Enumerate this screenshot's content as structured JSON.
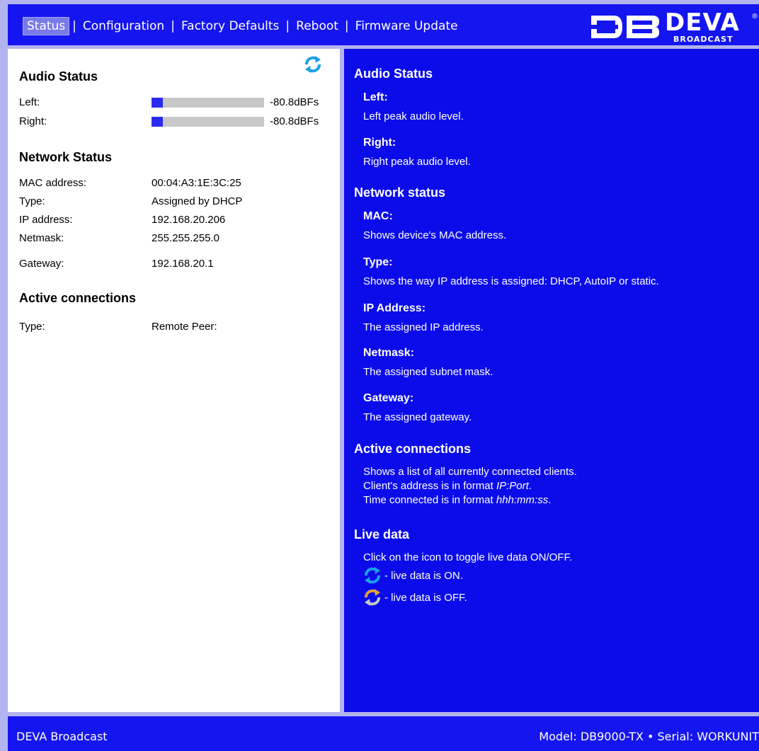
{
  "nav": {
    "items": [
      "Status",
      "Configuration",
      "Factory Defaults",
      "Reboot",
      "Firmware Update"
    ],
    "separator": "|",
    "active": "Status"
  },
  "logo": {
    "word": "DEVA",
    "sub": "BROADCAST",
    "reg": "®"
  },
  "left": {
    "audio_title": "Audio Status",
    "left_label": "Left:",
    "left_value": "-80.8dBFs",
    "left_level_fraction": 0.1,
    "right_label": "Right:",
    "right_value": "-80.8dBFs",
    "right_level_fraction": 0.1,
    "network_title": "Network Status",
    "network": [
      {
        "label": "MAC address:",
        "value": "00:04:A3:1E:3C:25"
      },
      {
        "label": "Type:",
        "value": "Assigned by DHCP"
      },
      {
        "label": "IP address:",
        "value": "192.168.20.206"
      },
      {
        "label": "Netmask:",
        "value": "255.255.255.0"
      },
      {
        "label": "Gateway:",
        "value": "192.168.20.1"
      }
    ],
    "connections_title": "Active connections",
    "conn_type_label": "Type:",
    "conn_peer_label": "Remote Peer:"
  },
  "help": {
    "audio_title": "Audio Status",
    "left_title": "Left:",
    "left_text": "Left peak audio level.",
    "right_title": "Right:",
    "right_text": "Right peak audio level.",
    "network_title": "Network status",
    "mac_title": "MAC:",
    "mac_text": "Shows device's MAC address.",
    "type_title": "Type:",
    "type_text": "Shows the way IP address is assigned: DHCP, AutoIP or static.",
    "ip_title": "IP Address:",
    "ip_text": "The assigned IP address.",
    "netmask_title": "Netmask:",
    "netmask_text": "The assigned subnet mask.",
    "gateway_title": "Gateway:",
    "gateway_text": "The assigned gateway.",
    "connections_title": "Active connections",
    "connections_line1": "Shows a list of all currently connected clients.",
    "connections_line2_prefix": "Client's address is in format ",
    "connections_line2_em": "IP:Port",
    "connections_line2_suffix": ".",
    "connections_line3_prefix": "Time connected is in format ",
    "connections_line3_em": "hhh:mm:ss",
    "connections_line3_suffix": ".",
    "live_title": "Live data",
    "live_text": "Click on the icon to toggle live data ON/OFF.",
    "live_on": "- live data is ON.",
    "live_off": "- live data is OFF."
  },
  "footer": {
    "brand": "DEVA Broadcast",
    "model": "Model: DB9000-TX • Serial: WORKUNIT"
  },
  "colors": {
    "accent": "#1515f0",
    "panel_blue": "#0c0ceb",
    "meter_fill": "#2b2bf0",
    "refresh_on": "#1aa0e6",
    "refresh_off": "#e0a040"
  },
  "icons": {
    "refresh": "refresh-icon"
  }
}
